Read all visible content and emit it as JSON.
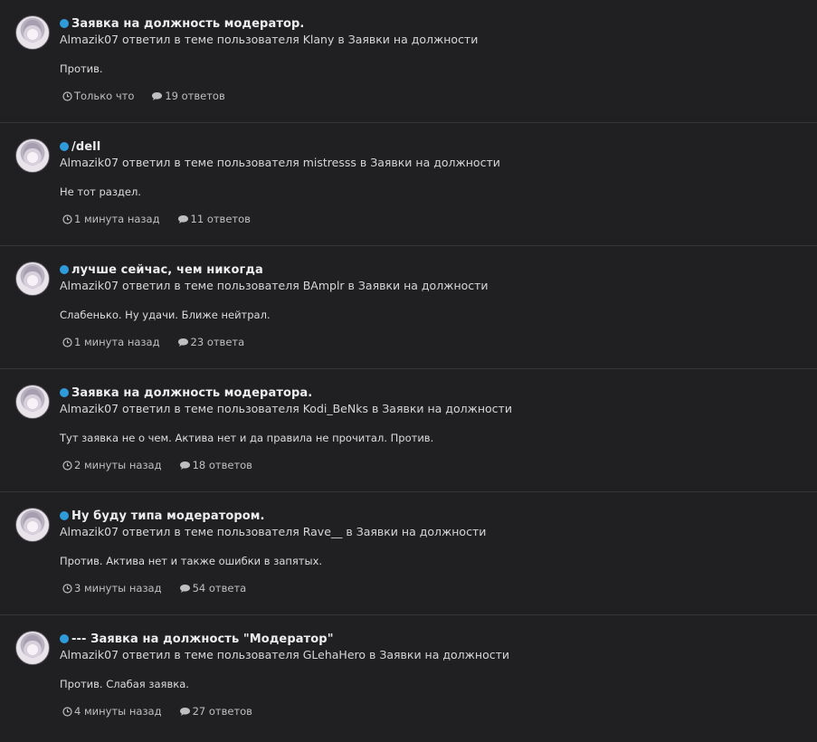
{
  "items": [
    {
      "title": "Заявка на должность модератор.",
      "meta": "Almazik07 ответил в теме пользователя Klany в Заявки на должности",
      "excerpt": "Против.",
      "time": "Только что",
      "replies": "19 ответов"
    },
    {
      "title": "/dell",
      "meta": "Almazik07 ответил в теме пользователя mistresss в Заявки на должности",
      "excerpt": "Не тот раздел.",
      "time": "1 минута назад",
      "replies": "11 ответов"
    },
    {
      "title": "лучше сейчас, чем никогда",
      "meta": "Almazik07 ответил в теме пользователя BAmplr в Заявки на должности",
      "excerpt": "Слабенько. Ну удачи. Ближе нейтрал.",
      "time": "1 минута назад",
      "replies": "23 ответа"
    },
    {
      "title": "Заявка на должность модератора.",
      "meta": "Almazik07 ответил в теме пользователя Kodi_BeNks в Заявки на должности",
      "excerpt": "Тут заявка не о чем. Актива нет и да правила не прочитал. Против.",
      "time": "2 минуты назад",
      "replies": "18 ответов"
    },
    {
      "title": "Ну буду типа модератором.",
      "meta": "Almazik07 ответил в теме пользователя Rave__ в Заявки на должности",
      "excerpt": "Против. Актива нет и также ошибки в запятых.",
      "time": "3 минуты назад",
      "replies": "54 ответа"
    },
    {
      "title": "--- Заявка на должность \"Модератор\"",
      "meta": "Almazik07 ответил в теме пользователя GLehaHero в Заявки на должности",
      "excerpt": "Против. Слабая заявка.",
      "time": "4 минуты назад",
      "replies": "27 ответов"
    }
  ],
  "icons": {
    "unread_dot": "unread-dot-icon",
    "time": "clock-icon",
    "replies": "comment-icon"
  },
  "colors": {
    "background": "#202023",
    "accent": "#2f9bd9",
    "title": "#eeeeee",
    "text": "#d7d7d7",
    "divider": "#34343a"
  }
}
